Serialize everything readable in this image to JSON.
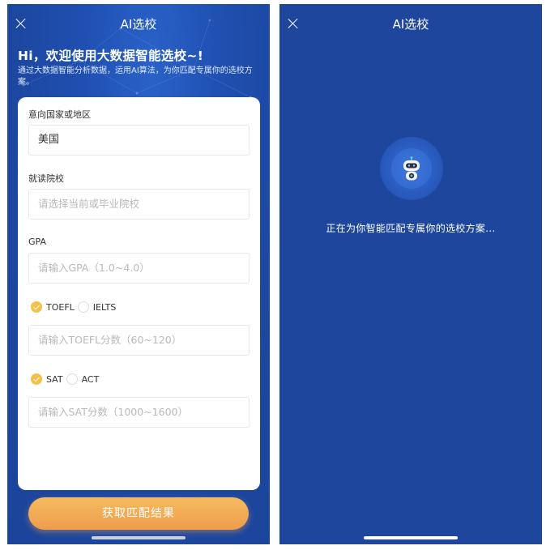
{
  "left_screen": {
    "nav": {
      "title": "AI选校",
      "close_icon": "close-icon"
    },
    "welcome_title": "Hi，欢迎使用大数据智能选校~!",
    "subtitle": "通过大数据智能分析数据，运用AI算法，为你匹配专属你的选校方案。",
    "form": {
      "country": {
        "label": "意向国家或地区",
        "value": "美国"
      },
      "school": {
        "label": "就读院校",
        "placeholder": "请选择当前或毕业院校"
      },
      "gpa": {
        "label": "GPA",
        "placeholder": "请输入GPA（1.0~4.0）"
      },
      "language_test": {
        "options": [
          {
            "label": "TOEFL",
            "selected": true
          },
          {
            "label": "IELTS",
            "selected": false
          }
        ],
        "placeholder": "请输入TOEFL分数（60~120）"
      },
      "standard_test": {
        "options": [
          {
            "label": "SAT",
            "selected": true
          },
          {
            "label": "ACT",
            "selected": false
          }
        ],
        "placeholder": "请输入SAT分数（1000~1600）"
      }
    },
    "submit_label": "获取匹配结果"
  },
  "right_screen": {
    "nav": {
      "title": "AI选校",
      "close_icon": "close-icon"
    },
    "robot_icon": "robot-icon",
    "loading_text": "正在为你智能匹配专属你的选校方案..."
  },
  "colors": {
    "background_blue": "#1d469c",
    "accent_yellow": "#f3c14a",
    "button_orange_top": "#f5bb60",
    "button_orange_bottom": "#ee9d4c"
  }
}
